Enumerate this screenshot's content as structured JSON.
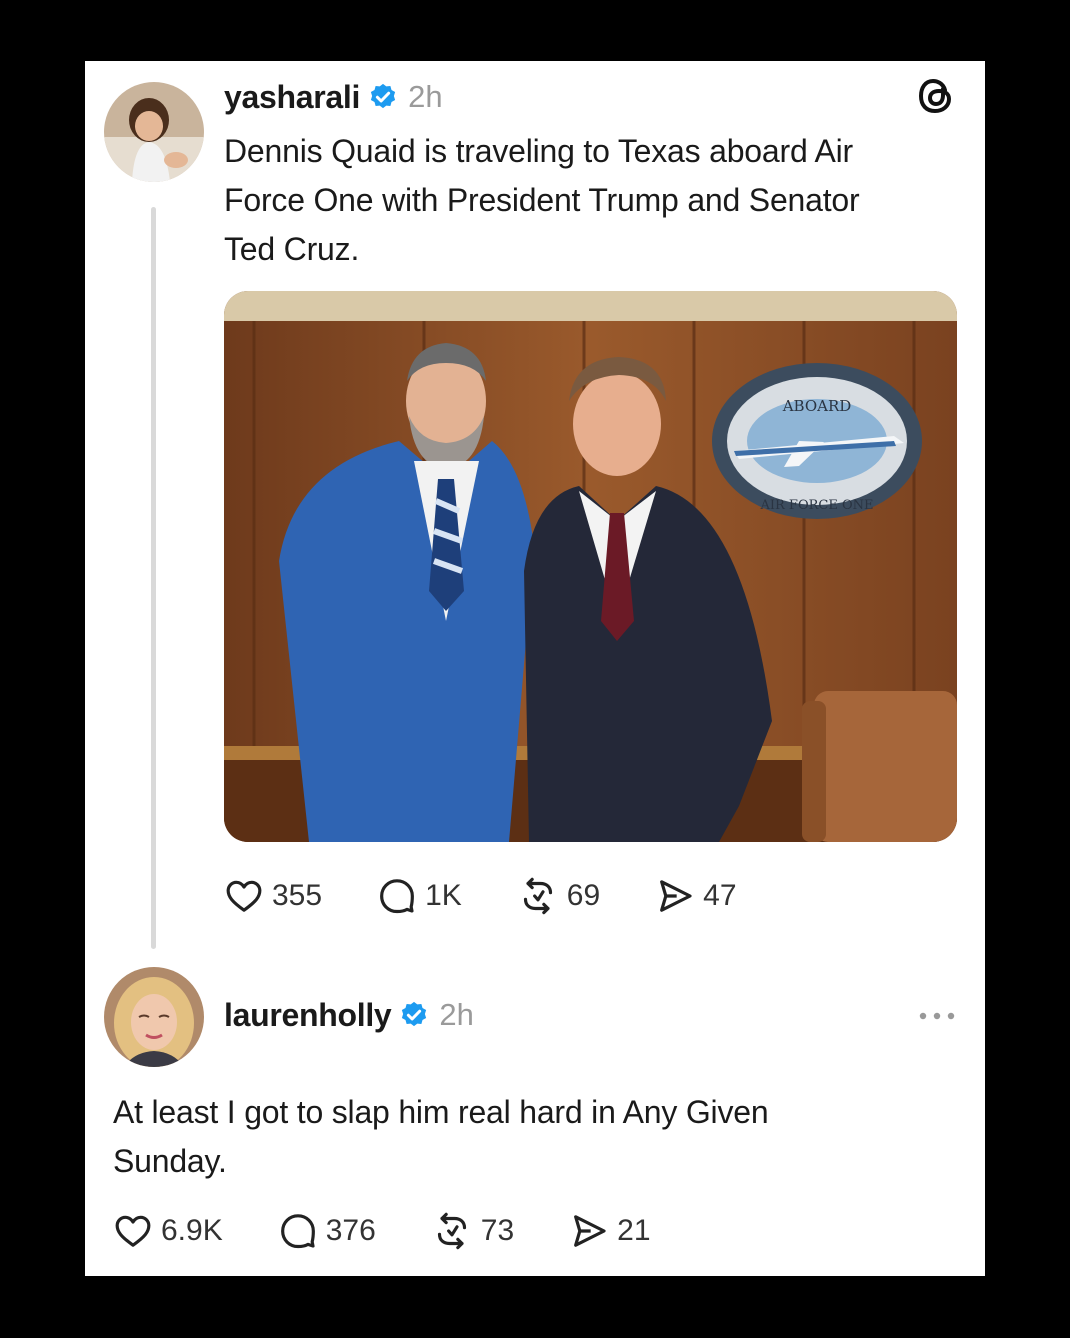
{
  "post": {
    "username": "yasharali",
    "time": "2h",
    "text_line1": "Dennis Quaid is traveling to Texas aboard Air",
    "text_line2": "Force One with President Trump and Senator",
    "text_line3": "Ted Cruz.",
    "photo_plaque_top": "ABOARD",
    "photo_plaque_bottom": "AIR  FORCE  ONE",
    "likes": "355",
    "replies": "1K",
    "reposts": "69",
    "shares": "47"
  },
  "reply": {
    "username": "laurenholly",
    "time": "2h",
    "text_line1": "At least I got to slap him real hard in Any Given",
    "text_line2": "Sunday.",
    "likes": "6.9K",
    "replies": "376",
    "reposts": "73",
    "shares": "21"
  },
  "icons": {
    "app": "threads-logo-icon",
    "verified": "verified-badge-icon",
    "like": "heart-icon",
    "reply": "comment-icon",
    "repost": "repost-icon",
    "share": "send-icon",
    "more": "more-dots-icon"
  },
  "colors": {
    "verified": "#1d9bf0",
    "text": "#1a1a1a",
    "muted": "#9a9a9a"
  }
}
